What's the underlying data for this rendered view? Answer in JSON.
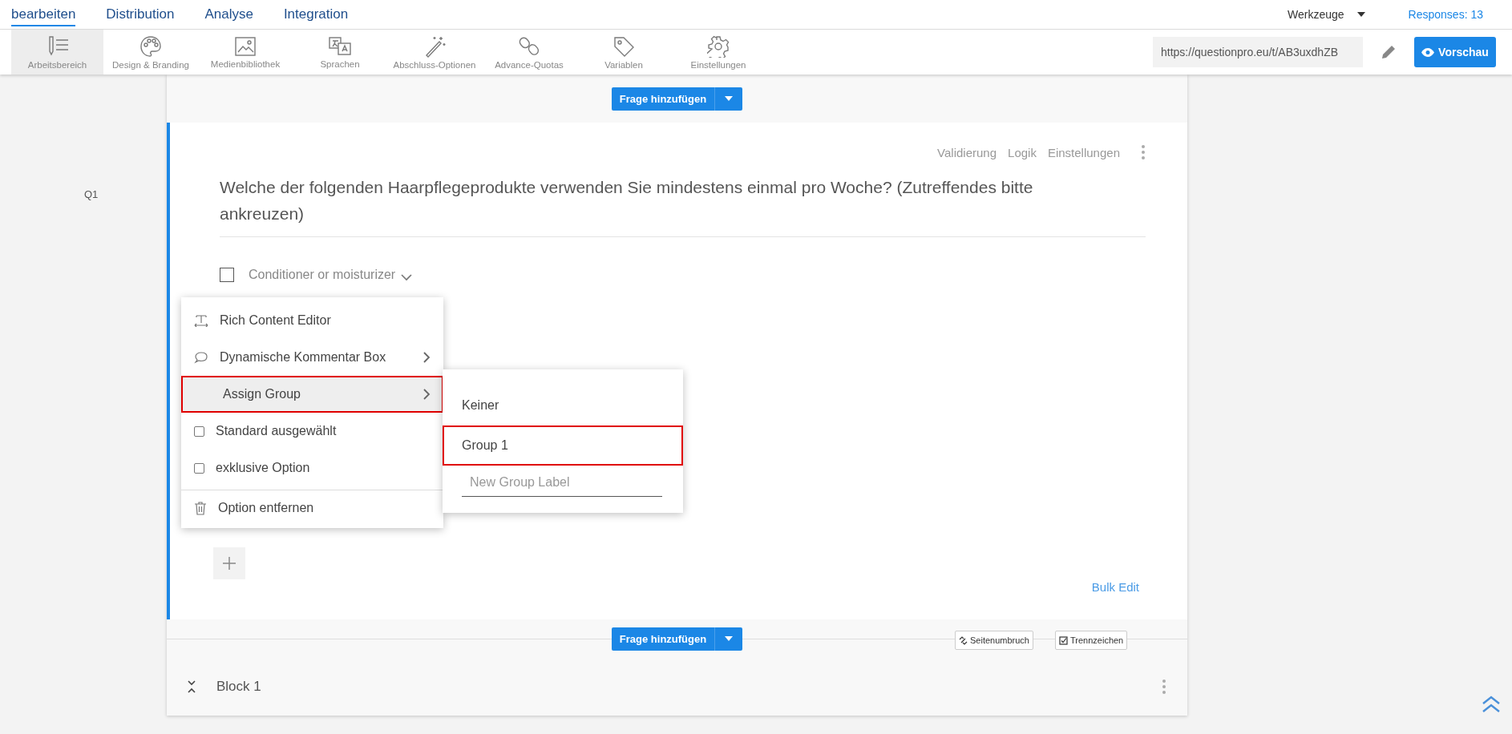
{
  "nav": {
    "tabs": [
      {
        "label": "bearbeiten",
        "selected": true
      },
      {
        "label": "Distribution",
        "selected": false
      },
      {
        "label": "Analyse",
        "selected": false
      },
      {
        "label": "Integration",
        "selected": false
      }
    ],
    "tools": "Werkzeuge",
    "responses": "Responses: 13"
  },
  "toolbar": {
    "items": [
      {
        "kind": "workspace",
        "label": "Arbeitsbereich",
        "selected": true
      },
      {
        "kind": "palette",
        "label": "Design & Branding",
        "selected": false
      },
      {
        "kind": "image",
        "label": "Medienbibliothek",
        "selected": false
      },
      {
        "kind": "language",
        "label": "Sprachen",
        "selected": false
      },
      {
        "kind": "wand",
        "label": "Abschluss-Optionen",
        "selected": false
      },
      {
        "kind": "link",
        "label": "Advance-Quotas",
        "selected": false
      },
      {
        "kind": "tag",
        "label": "Variablen",
        "selected": false
      },
      {
        "kind": "gear",
        "label": "Einstellungen",
        "selected": false
      }
    ],
    "url": "https://questionpro.eu/t/AB3uxdhZB",
    "preview": "Vorschau"
  },
  "add_question": "Frage hinzufügen",
  "question": {
    "number": "Q1",
    "actions": [
      "Validierung",
      "Logik",
      "Einstellungen"
    ],
    "text": "Welche der folgenden Haarpflegeprodukte verwenden Sie mindestens einmal pro Woche? (Zutreffendes bitte ankreuzen)",
    "options": [
      {
        "label": "Conditioner or moisturizer",
        "checked": false
      }
    ],
    "bulk_edit": "Bulk Edit"
  },
  "context_menu": {
    "items": [
      {
        "kind": "rich",
        "label": "Rich Content Editor",
        "selected": false
      },
      {
        "kind": "comment",
        "label": "Dynamische Kommentar Box",
        "selected": false
      },
      {
        "kind": "submenu",
        "label": "Assign Group",
        "selected": true
      },
      {
        "kind": "checkbox",
        "label": "Standard ausgewählt",
        "checked": false
      },
      {
        "kind": "checkbox",
        "label": "exklusive Option",
        "checked": false
      },
      {
        "kind": "delete",
        "label": "Option entfernen",
        "selected": false
      }
    ]
  },
  "group_menu": {
    "items": [
      {
        "label": "Keiner",
        "selected": false
      },
      {
        "label": "Group 1",
        "selected": true
      }
    ],
    "field": {
      "placeholder": "New Group Label"
    }
  },
  "footer": {
    "add_question": "Frage hinzufügen",
    "page_break": "Seitenumbruch",
    "separator": "Trennzeichen",
    "block": "Block 1"
  }
}
